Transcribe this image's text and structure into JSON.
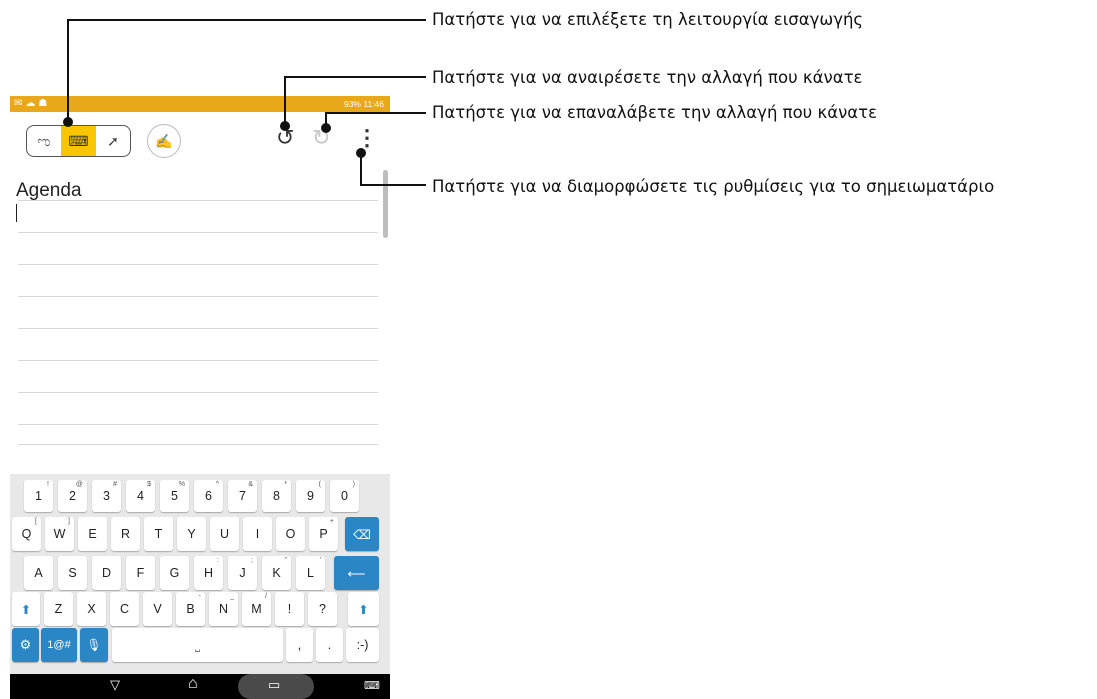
{
  "callouts": [
    {
      "text": "Πατήστε για να επιλέξετε τη λειτουργία εισαγωγής"
    },
    {
      "text": "Πατήστε για να αναιρέσετε την αλλαγή που κάνατε"
    },
    {
      "text": "Πατήστε για να επαναλάβετε την αλλαγή που κάνατε"
    },
    {
      "text": "Πατήστε για να διαμορφώσετε τις ρυθμίσεις για το σημειωματάριο"
    }
  ],
  "status_bar": {
    "battery": "93%",
    "time": "11:46",
    "color": "#e9a81a"
  },
  "toolbar": {
    "modes": [
      {
        "name": "handwriting-mode",
        "icon": "handwriting-icon",
        "glyph": "ಌ"
      },
      {
        "name": "keyboard-mode",
        "icon": "keyboard-icon",
        "glyph": "⌨"
      },
      {
        "name": "draw-mode",
        "icon": "brush-icon",
        "glyph": "➚"
      }
    ],
    "active_mode": "keyboard-mode",
    "accent": "#f9c400",
    "pen_glyph": "✍",
    "undo_glyph": "↺",
    "redo_glyph": "↻",
    "more_glyph": "⋮"
  },
  "note": {
    "title": "Agenda"
  },
  "keyboard": {
    "row1": [
      [
        "1",
        "!"
      ],
      [
        "2",
        "@"
      ],
      [
        "3",
        "#"
      ],
      [
        "4",
        "$"
      ],
      [
        "5",
        "%"
      ],
      [
        "6",
        "^"
      ],
      [
        "7",
        "&"
      ],
      [
        "8",
        "*"
      ],
      [
        "9",
        "("
      ],
      [
        "0",
        ")"
      ]
    ],
    "row2": [
      [
        "Q",
        "["
      ],
      [
        "W",
        "]"
      ],
      [
        "E",
        ""
      ],
      [
        "R",
        ""
      ],
      [
        "T",
        ""
      ],
      [
        "Y",
        ""
      ],
      [
        "U",
        ""
      ],
      [
        "I",
        ""
      ],
      [
        "O",
        ""
      ],
      [
        "P",
        "+"
      ]
    ],
    "row3": [
      [
        "A",
        ""
      ],
      [
        "S",
        ""
      ],
      [
        "D",
        ""
      ],
      [
        "F",
        ""
      ],
      [
        "G",
        ""
      ],
      [
        "H",
        ":"
      ],
      [
        "J",
        ";"
      ],
      [
        "K",
        "\""
      ],
      [
        "L",
        "'"
      ]
    ],
    "row4": [
      [
        "Z",
        ""
      ],
      [
        "X",
        ""
      ],
      [
        "C",
        ""
      ],
      [
        "V",
        ""
      ],
      [
        "B",
        "-"
      ],
      [
        "N",
        "_"
      ],
      [
        "M",
        "/"
      ],
      [
        "!",
        ""
      ],
      [
        "?",
        ""
      ]
    ],
    "symbols_label": "1@#",
    "comma": ",",
    "period": ".",
    "smiley": ":-)",
    "backspace_glyph": "⌫",
    "enter_glyph": "⟵",
    "shift_glyph": "⬆",
    "settings_glyph": "⚙",
    "mic_glyph": "🎙",
    "space_glyph": "⎵",
    "accent": "#2b86c5"
  },
  "nav_bar": {
    "back_glyph": "▽",
    "home_glyph": "⌂",
    "recents_glyph": "▭",
    "keyboard_glyph": "⌨"
  }
}
